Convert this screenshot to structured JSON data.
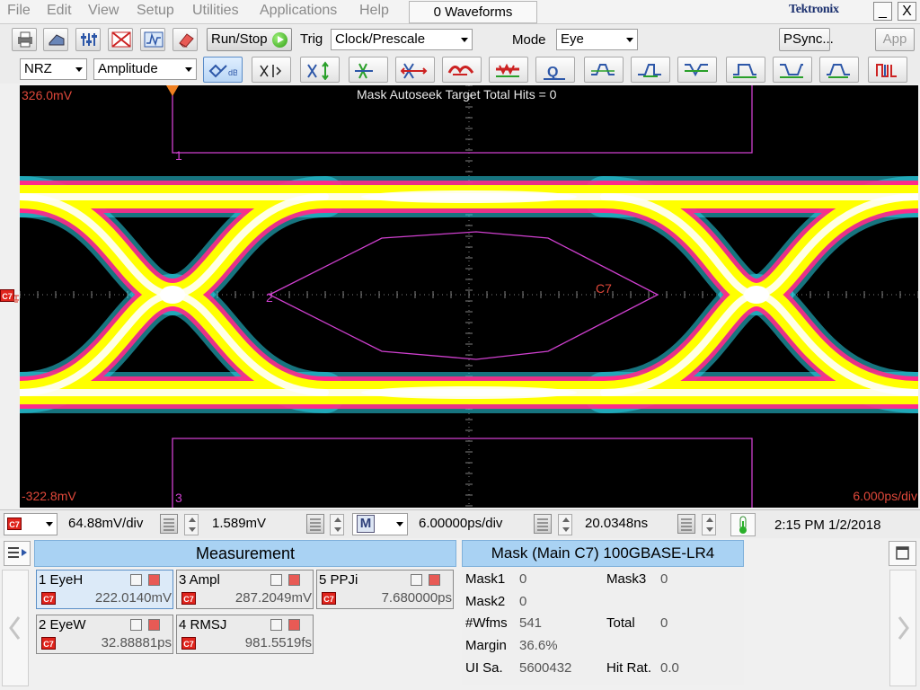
{
  "menubar": {
    "items": [
      "File",
      "Edit",
      "View",
      "Setup",
      "Utilities",
      "Applications",
      "Help"
    ],
    "waveforms": "0 Waveforms",
    "brand": "Tektronix",
    "minimize": "_",
    "close": "X"
  },
  "toolbar1": {
    "run_stop": "Run/Stop",
    "trig_label": "Trig",
    "trig_value": "Clock/Prescale",
    "mode_label": "Mode",
    "mode_value": "Eye",
    "psync": "PSync...",
    "app": "App"
  },
  "toolbar2": {
    "signal_type": "NRZ",
    "measure_class": "Amplitude"
  },
  "display": {
    "top_voltage": "326.0mV",
    "bottom_voltage": "-322.8mV",
    "timebase": "6.000ps/div",
    "autoseek": "Mask Autoseek Target Total Hits = 0",
    "mask_labels": [
      "1",
      "2",
      "3"
    ],
    "channel_label": "C7",
    "left_channel": "C7"
  },
  "ctrlbar": {
    "channel": "C7",
    "vert_scale": "64.88mV/div",
    "vert_offset": "1.589mV",
    "math_btn": "M",
    "horiz_scale": "6.00000ps/div",
    "horiz_pos": "20.0348ns",
    "datetime": "2:15 PM 1/2/2018"
  },
  "measurement": {
    "title": "Measurement",
    "items": [
      {
        "name": "1 EyeH",
        "value": "222.0140mV",
        "channel": "C7"
      },
      {
        "name": "2 EyeW",
        "value": "32.88881ps",
        "channel": "C7"
      },
      {
        "name": "3 Ampl",
        "value": "287.2049mV",
        "channel": "C7"
      },
      {
        "name": "4 RMSJ",
        "value": "981.5519fs",
        "channel": "C7"
      },
      {
        "name": "5 PPJi",
        "value": "7.680000ps",
        "channel": "C7"
      }
    ]
  },
  "mask": {
    "title": "Mask (Main  C7) 100GBASE-LR4",
    "rows": [
      {
        "label": "Mask1",
        "value": "0"
      },
      {
        "label": "Mask3",
        "value": "0"
      },
      {
        "label": "Mask2",
        "value": "0"
      },
      {
        "label": "#Wfms",
        "value": "541"
      },
      {
        "label": "Total",
        "value": "0"
      },
      {
        "label": "Margin",
        "value": "36.6%"
      },
      {
        "label": "UI Sa.",
        "value": "5600432"
      },
      {
        "label": "Hit Rat.",
        "value": "0.0"
      }
    ]
  },
  "colors": {
    "scope_bg": "#000000",
    "eye_core": "#ffffff",
    "eye_yellow": "#ffff00",
    "eye_magenta": "#ff2a8a",
    "eye_cyan": "#2ad4e8",
    "mask_line": "#d040d0",
    "label_red": "#e0483a",
    "header_blue": "#a9d2f3"
  },
  "icons": [
    "print-icon",
    "file-icon",
    "setup-icon",
    "mask-icon",
    "autoscale-icon",
    "eraser-icon",
    "chevron-down-icon"
  ]
}
